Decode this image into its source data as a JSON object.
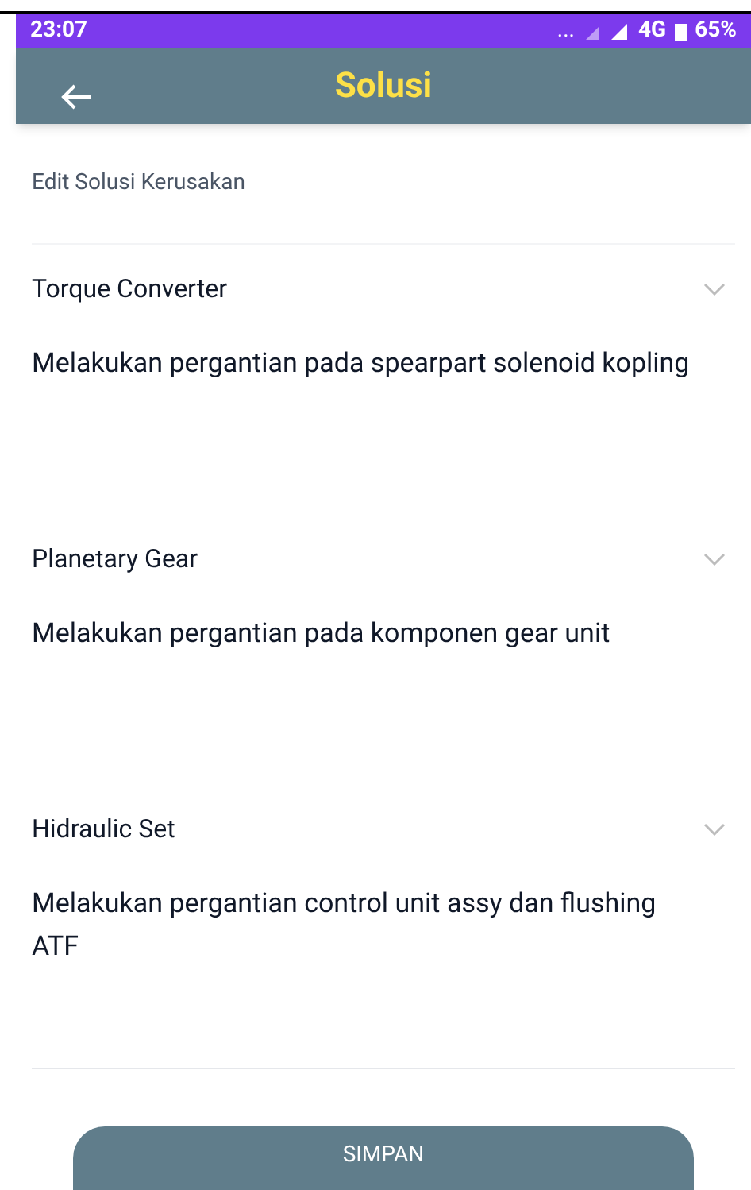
{
  "status_bar": {
    "time": "23:07",
    "indicators": "...",
    "network": "4G",
    "battery": "65%"
  },
  "app_bar": {
    "title": "Solusi"
  },
  "section_label": "Edit Solusi Kerusakan",
  "solutions": [
    {
      "component": "Torque Converter",
      "text": "Melakukan pergantian pada spearpart solenoid kopling"
    },
    {
      "component": "Planetary Gear",
      "text": "Melakukan pergantian pada komponen gear unit"
    },
    {
      "component": "Hidraulic Set",
      "text": "Melakukan pergantian control unit assy dan flushing ATF"
    }
  ],
  "save_button": "SIMPAN"
}
